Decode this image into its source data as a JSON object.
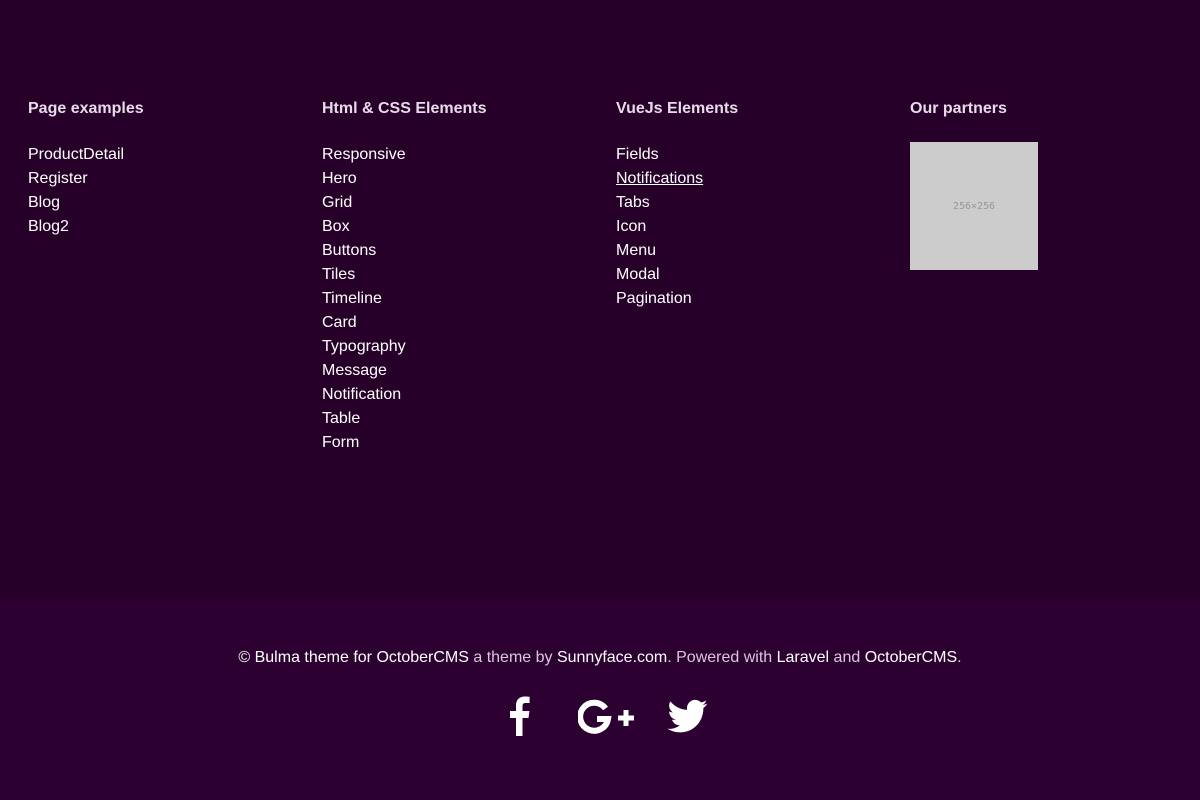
{
  "columns": [
    {
      "title": "Page examples",
      "links": [
        "ProductDetail",
        "Register",
        "Blog",
        "Blog2"
      ]
    },
    {
      "title": "Html & CSS Elements",
      "links": [
        "Responsive",
        "Hero",
        "Grid",
        "Box",
        "Buttons",
        "Tiles",
        "Timeline",
        "Card",
        "Typography",
        "Message",
        "Notification",
        "Table",
        "Form"
      ]
    },
    {
      "title": "VueJs Elements",
      "links": [
        "Fields",
        "Notifications",
        "Tabs",
        "Icon",
        "Menu",
        "Modal",
        "Pagination"
      ]
    },
    {
      "title": "Our partners",
      "partner_image_text": "256×256"
    }
  ],
  "credits": {
    "prefix": "© Bulma theme for OctoberCMS",
    "by_text": " a theme by ",
    "author": "Sunnyface.com",
    "powered_text": ". Powered with ",
    "laravel": "Laravel",
    "and_text": " and ",
    "octobercms": "OctoberCMS",
    "suffix": "."
  },
  "social": {
    "icons": [
      "facebook-icon",
      "google-plus-icon",
      "twitter-icon"
    ]
  },
  "colors": {
    "top_background": "#260029",
    "bottom_background": "#2d0032",
    "heading": "#e7dbe9",
    "link": "#ffffff",
    "muted_text": "#d9c8dc",
    "partner_placeholder": "#cccccc"
  }
}
